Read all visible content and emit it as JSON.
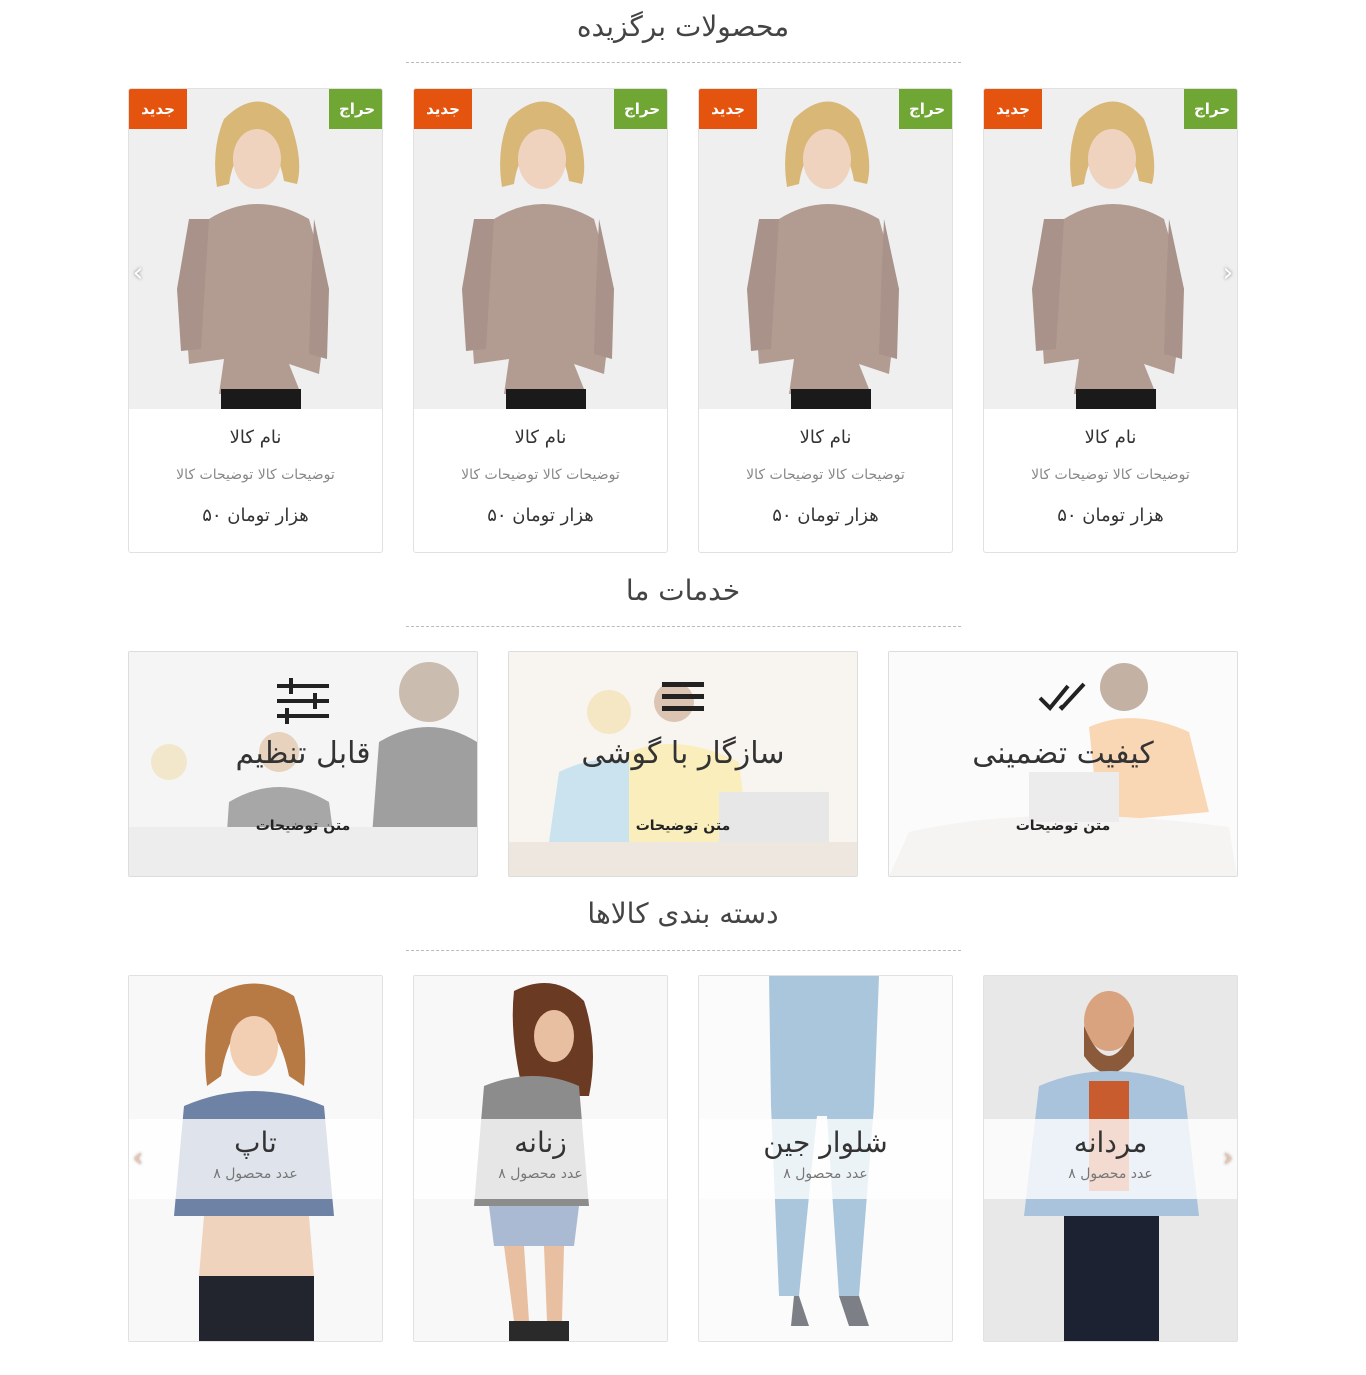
{
  "featured": {
    "title": "محصولات برگزیده",
    "products": [
      {
        "badge_sale": "حراج",
        "badge_new": "جدید",
        "name": "نام کالا",
        "desc": "توضیحات کالا توضیحات کالا",
        "price": "۵۰ هزار تومان"
      },
      {
        "badge_sale": "حراج",
        "badge_new": "جدید",
        "name": "نام کالا",
        "desc": "توضیحات کالا توضیحات کالا",
        "price": "۵۰ هزار تومان"
      },
      {
        "badge_sale": "حراج",
        "badge_new": "جدید",
        "name": "نام کالا",
        "desc": "توضیحات کالا توضیحات کالا",
        "price": "۵۰ هزار تومان"
      },
      {
        "badge_sale": "حراج",
        "badge_new": "جدید",
        "name": "نام کالا",
        "desc": "توضیحات کالا توضیحات کالا",
        "price": "۵۰ هزار تومان"
      }
    ],
    "prev_arrow": "‹",
    "next_arrow": "›"
  },
  "services": {
    "title": "خدمات ما",
    "items": [
      {
        "title": "کیفیت تضمینی",
        "text": "متن توضیحات",
        "icon": "double-check-icon"
      },
      {
        "title": "سازگار با گوشی",
        "text": "متن توضیحات",
        "icon": "menu-lines-icon"
      },
      {
        "title": "قابل تنظیم",
        "text": "متن توضیحات",
        "icon": "sliders-icon"
      }
    ]
  },
  "categories": {
    "title": "دسته بندی کالاها",
    "items": [
      {
        "name": "مردانه",
        "count": "۸ عدد محصول"
      },
      {
        "name": "شلوار جین",
        "count": "۸ عدد محصول"
      },
      {
        "name": "زنانه",
        "count": "۸ عدد محصول"
      },
      {
        "name": "تاپ",
        "count": "۸ عدد محصول"
      }
    ],
    "prev_arrow": "‹",
    "next_arrow": "›"
  }
}
